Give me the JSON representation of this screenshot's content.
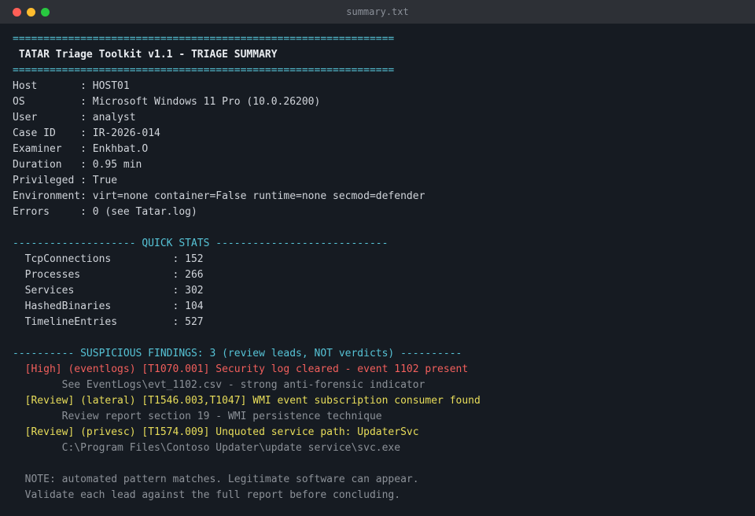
{
  "window": {
    "title": "summary.txt",
    "colors": {
      "close": "#ff5f57",
      "minimize": "#febc2e",
      "zoom": "#28c840"
    }
  },
  "header": {
    "rule": "==============================================================",
    "title": " TATAR Triage Toolkit v1.1 - TRIAGE SUMMARY"
  },
  "info": [
    {
      "label": "Host       ",
      "value": "HOST01"
    },
    {
      "label": "OS         ",
      "value": "Microsoft Windows 11 Pro (10.0.26200)"
    },
    {
      "label": "User       ",
      "value": "analyst"
    },
    {
      "label": "Case ID    ",
      "value": "IR-2026-014"
    },
    {
      "label": "Examiner   ",
      "value": "Enkhbat.O"
    },
    {
      "label": "Duration   ",
      "value": "0.95 min"
    },
    {
      "label": "Privileged ",
      "value": "True"
    },
    {
      "label": "Environment",
      "value": "virt=none container=False runtime=none secmod=defender"
    },
    {
      "label": "Errors     ",
      "value": "0 (see Tatar.log)"
    }
  ],
  "quick_stats": {
    "header": "-------------------- QUICK STATS ----------------------------",
    "items": [
      {
        "name": "  TcpConnections          ",
        "value": "152"
      },
      {
        "name": "  Processes               ",
        "value": "266"
      },
      {
        "name": "  Services                ",
        "value": "302"
      },
      {
        "name": "  HashedBinaries          ",
        "value": "104"
      },
      {
        "name": "  TimelineEntries         ",
        "value": "527"
      }
    ]
  },
  "findings": {
    "header": "---------- SUSPICIOUS FINDINGS: 3 (review leads, NOT verdicts) ----------",
    "items": [
      {
        "text": "  [High] (eventlogs) [T1070.001] Security log cleared - event 1102 present",
        "detail": "        See EventLogs\\evt_1102.csv - strong anti-forensic indicator"
      },
      {
        "text": "  [Review] (lateral) [T1546.003,T1047] WMI event subscription consumer found",
        "detail": "        Review report section 19 - WMI persistence technique"
      },
      {
        "text": "  [Review] (privesc) [T1574.009] Unquoted service path: UpdaterSvc",
        "detail": "        C:\\Program Files\\Contoso Updater\\update service\\svc.exe"
      }
    ]
  },
  "note": {
    "line1": "  NOTE: automated pattern matches. Legitimate software can appear.",
    "line2": "  Validate each lead against the full report before concluding."
  }
}
